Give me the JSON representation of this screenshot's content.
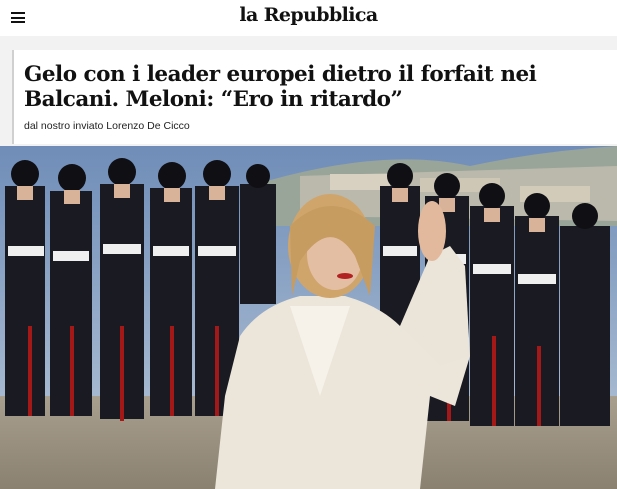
{
  "header": {
    "menu_icon": "hamburger-menu-icon",
    "logo_text": "la Repubblica"
  },
  "article": {
    "headline": "Gelo con i leader europei dietro il forfait nei Balcani. Meloni: “Ero in ritardo”",
    "byline": "dal nostro inviato Lorenzo De Cicco",
    "hero_image": "photo-woman-in-white-suit-hands-together-before-carabinieri-parade"
  },
  "colors": {
    "background": "#f2f2f2",
    "text": "#111111",
    "uniform": "#15151d",
    "stripe": "#b01818",
    "suit": "#ece6da"
  }
}
